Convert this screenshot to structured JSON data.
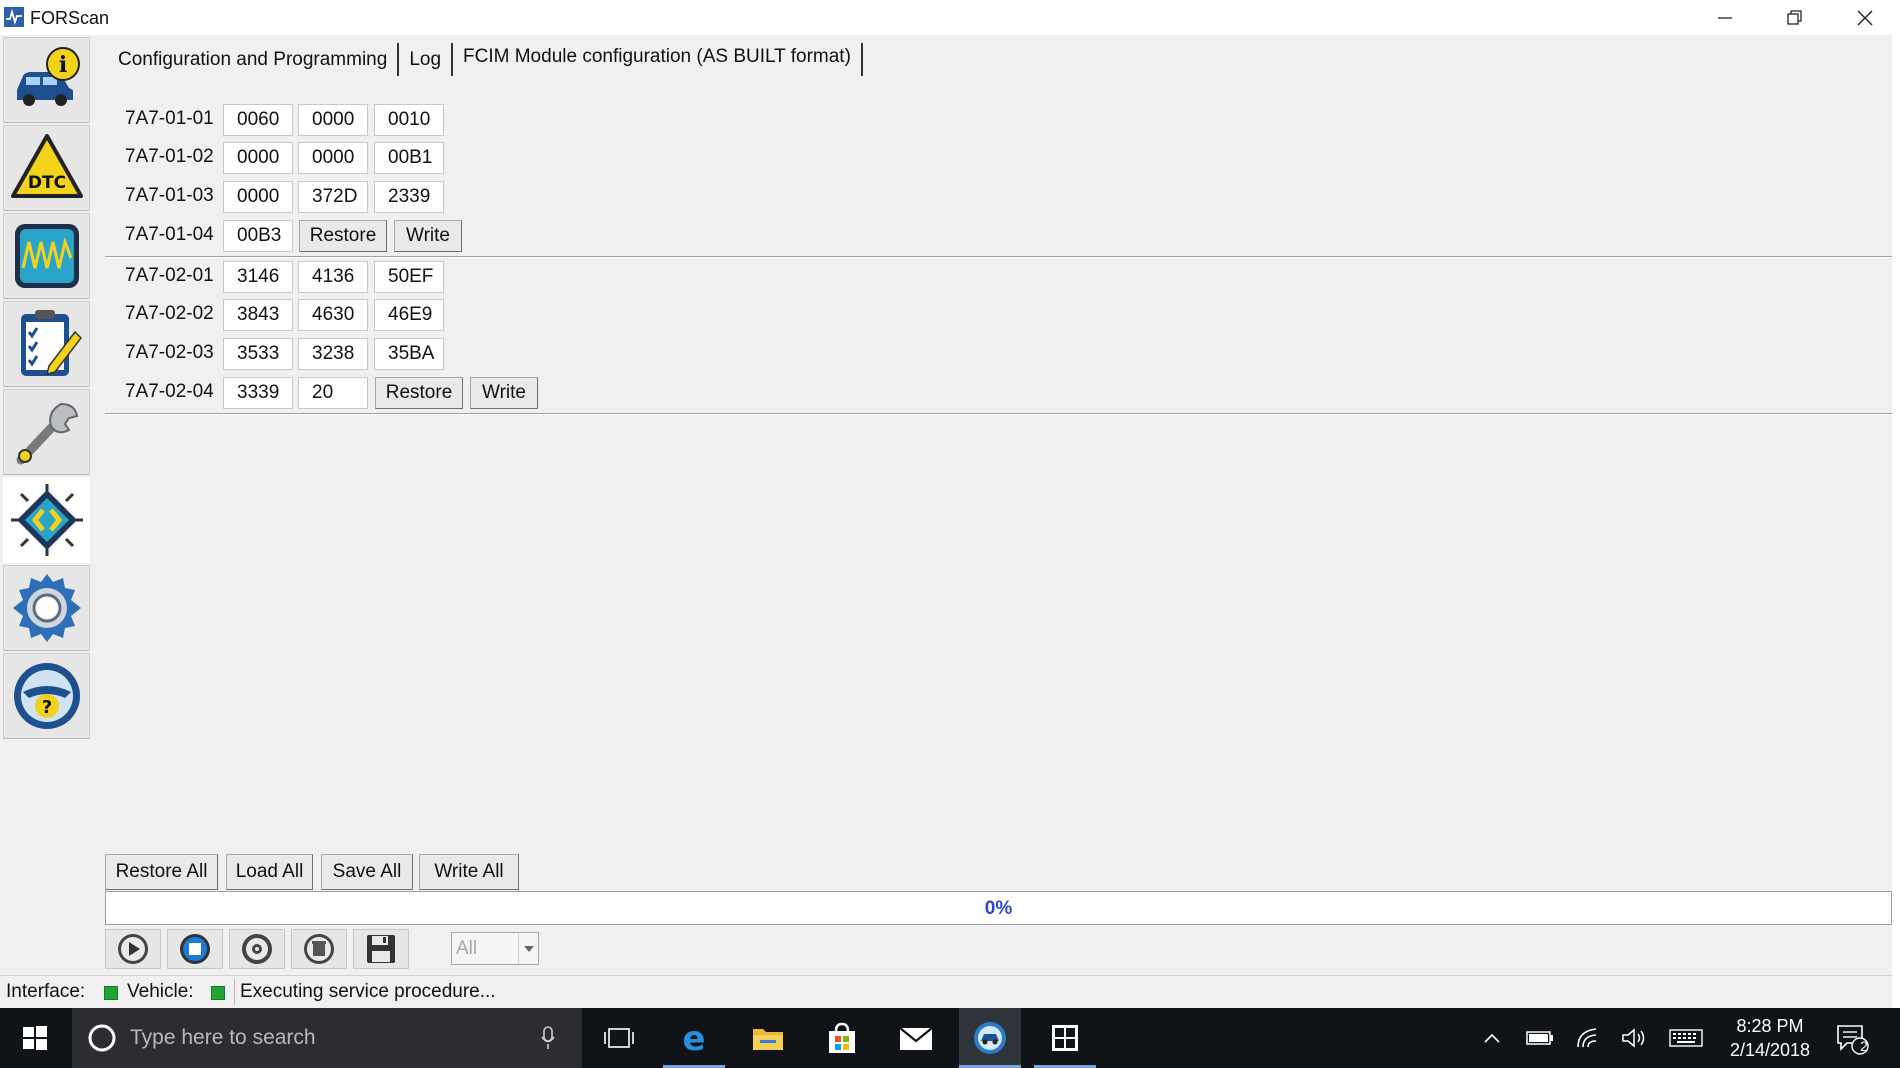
{
  "window": {
    "title": "FORScan",
    "icon": "forscan-app-icon"
  },
  "sidebar": {
    "items": [
      {
        "name": "vehicle-info",
        "icon": "car-info-icon"
      },
      {
        "name": "dtc",
        "icon": "dtc-warning-icon",
        "text": "DTC"
      },
      {
        "name": "oscilloscope",
        "icon": "oscilloscope-icon"
      },
      {
        "name": "tests",
        "icon": "checklist-icon"
      },
      {
        "name": "service",
        "icon": "wrench-icon"
      },
      {
        "name": "configuration",
        "icon": "chip-config-icon",
        "active": true
      },
      {
        "name": "settings",
        "icon": "gear-icon"
      },
      {
        "name": "help",
        "icon": "help-wheel-icon",
        "text": "?"
      }
    ]
  },
  "tabs": [
    {
      "label": "Configuration and Programming"
    },
    {
      "label": "Log"
    },
    {
      "label": "FCIM Module configuration (AS BUILT format)",
      "active": true
    }
  ],
  "config": {
    "block1": [
      {
        "label": "7A7-01-01",
        "cells": [
          "0060",
          "0000",
          "0010"
        ]
      },
      {
        "label": "7A7-01-02",
        "cells": [
          "0000",
          "0000",
          "00B1"
        ]
      },
      {
        "label": "7A7-01-03",
        "cells": [
          "0000",
          "372D",
          "2339"
        ]
      },
      {
        "label": "7A7-01-04",
        "cells": [
          "00B3"
        ],
        "restore": "Restore",
        "write": "Write"
      }
    ],
    "block2": [
      {
        "label": "7A7-02-01",
        "cells": [
          "3146",
          "4136",
          "50EF"
        ]
      },
      {
        "label": "7A7-02-02",
        "cells": [
          "3843",
          "4630",
          "46E9"
        ]
      },
      {
        "label": "7A7-02-03",
        "cells": [
          "3533",
          "3238",
          "35BA"
        ]
      },
      {
        "label": "7A7-02-04",
        "cells": [
          "3339",
          "20"
        ],
        "restore": "Restore",
        "write": "Write"
      }
    ]
  },
  "bottom_buttons": {
    "restore_all": "Restore All",
    "load_all": "Load All",
    "save_all": "Save All",
    "write_all": "Write All"
  },
  "progress": {
    "text": "0%",
    "value": 0
  },
  "toolbar": {
    "filter_value": "All",
    "icons": [
      "play-icon",
      "stop-icon",
      "disc-icon",
      "clear-icon",
      "save-icon"
    ]
  },
  "status": {
    "interface_label": "Interface:",
    "vehicle_label": "Vehicle:",
    "message": "Executing service procedure...",
    "led_color": "#1ea534"
  },
  "taskbar": {
    "search_placeholder": "Type here to search",
    "time": "8:28 PM",
    "date": "2/14/2018",
    "notification_count": "2"
  }
}
